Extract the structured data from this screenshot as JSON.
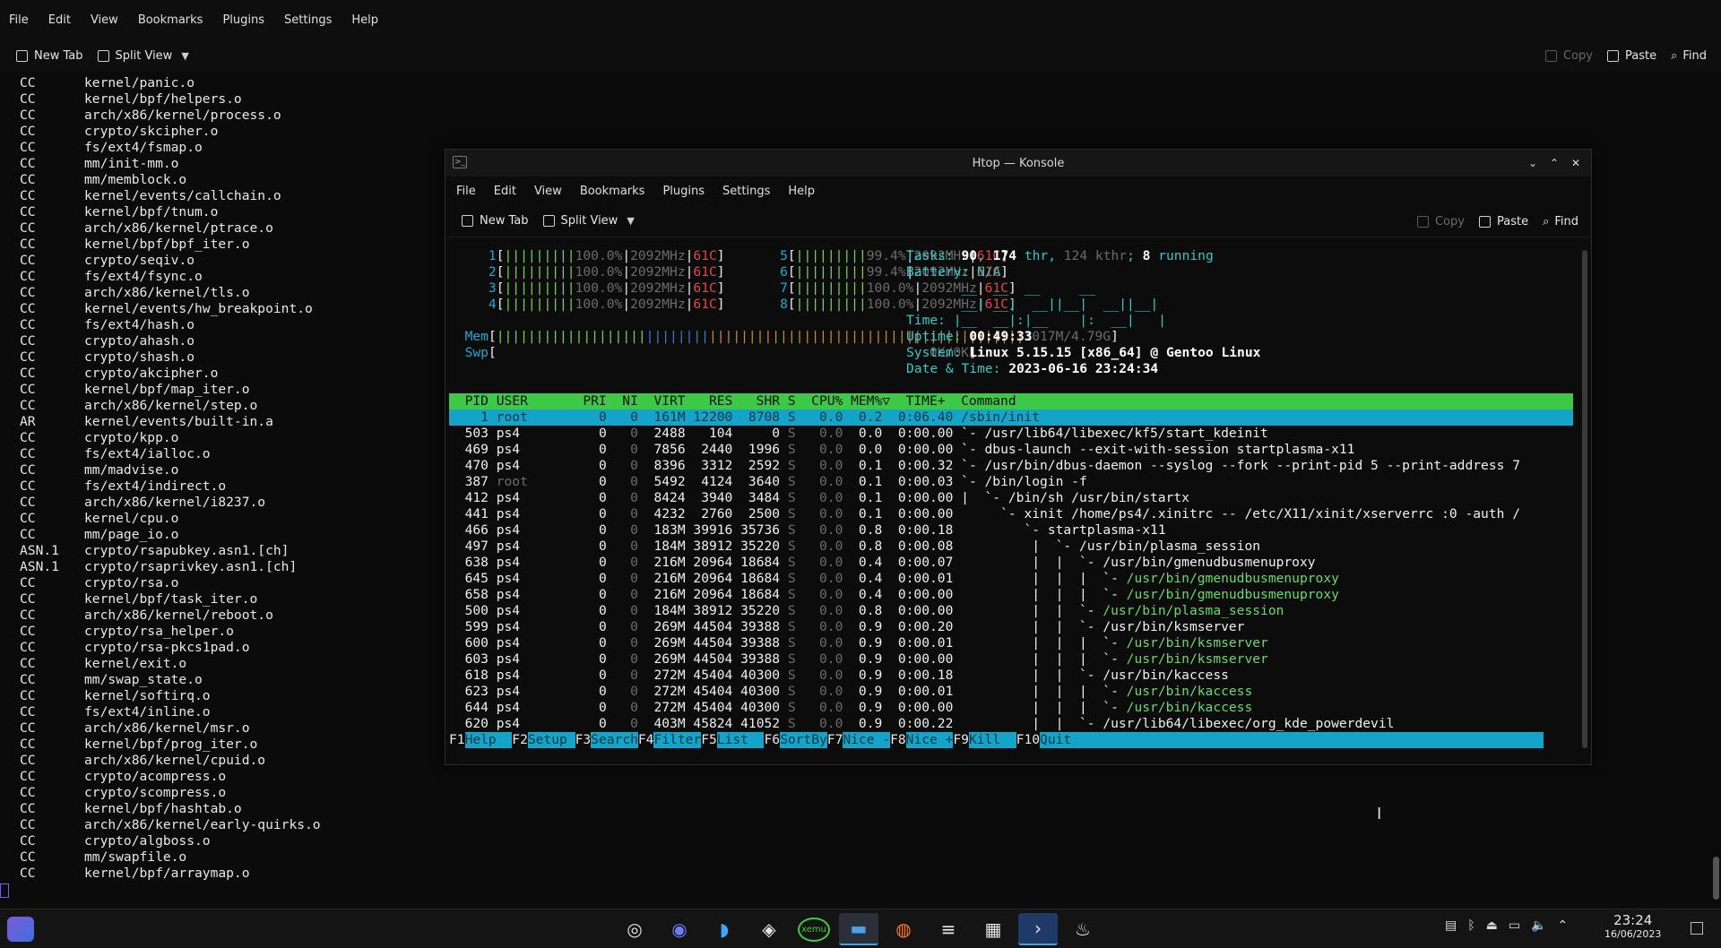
{
  "menu": [
    "File",
    "Edit",
    "View",
    "Bookmarks",
    "Plugins",
    "Settings",
    "Help"
  ],
  "toolbar": {
    "new_tab": "New Tab",
    "split_view": "Split View",
    "copy": "Copy",
    "paste": "Paste",
    "find": "Find"
  },
  "build_log": [
    [
      "CC",
      "kernel/panic.o"
    ],
    [
      "CC",
      "kernel/bpf/helpers.o"
    ],
    [
      "CC",
      "arch/x86/kernel/process.o"
    ],
    [
      "CC",
      "crypto/skcipher.o"
    ],
    [
      "CC",
      "fs/ext4/fsmap.o"
    ],
    [
      "CC",
      "mm/init-mm.o"
    ],
    [
      "CC",
      "mm/memblock.o"
    ],
    [
      "CC",
      "kernel/events/callchain.o"
    ],
    [
      "CC",
      "kernel/bpf/tnum.o"
    ],
    [
      "CC",
      "arch/x86/kernel/ptrace.o"
    ],
    [
      "CC",
      "kernel/bpf/bpf_iter.o"
    ],
    [
      "CC",
      "crypto/seqiv.o"
    ],
    [
      "CC",
      "fs/ext4/fsync.o"
    ],
    [
      "CC",
      "arch/x86/kernel/tls.o"
    ],
    [
      "CC",
      "kernel/events/hw_breakpoint.o"
    ],
    [
      "CC",
      "fs/ext4/hash.o"
    ],
    [
      "CC",
      "crypto/ahash.o"
    ],
    [
      "CC",
      "crypto/shash.o"
    ],
    [
      "CC",
      "crypto/akcipher.o"
    ],
    [
      "CC",
      "kernel/bpf/map_iter.o"
    ],
    [
      "CC",
      "arch/x86/kernel/step.o"
    ],
    [
      "AR",
      "kernel/events/built-in.a"
    ],
    [
      "CC",
      "crypto/kpp.o"
    ],
    [
      "CC",
      "fs/ext4/ialloc.o"
    ],
    [
      "CC",
      "mm/madvise.o"
    ],
    [
      "CC",
      "fs/ext4/indirect.o"
    ],
    [
      "CC",
      "arch/x86/kernel/i8237.o"
    ],
    [
      "CC",
      "kernel/cpu.o"
    ],
    [
      "CC",
      "mm/page_io.o"
    ],
    [
      "ASN.1",
      "crypto/rsapubkey.asn1.[ch]"
    ],
    [
      "ASN.1",
      "crypto/rsaprivkey.asn1.[ch]"
    ],
    [
      "CC",
      "crypto/rsa.o"
    ],
    [
      "CC",
      "kernel/bpf/task_iter.o"
    ],
    [
      "CC",
      "arch/x86/kernel/reboot.o"
    ],
    [
      "CC",
      "crypto/rsa_helper.o"
    ],
    [
      "CC",
      "crypto/rsa-pkcs1pad.o"
    ],
    [
      "CC",
      "kernel/exit.o"
    ],
    [
      "CC",
      "mm/swap_state.o"
    ],
    [
      "CC",
      "kernel/softirq.o"
    ],
    [
      "CC",
      "fs/ext4/inline.o"
    ],
    [
      "CC",
      "arch/x86/kernel/msr.o"
    ],
    [
      "CC",
      "kernel/bpf/prog_iter.o"
    ],
    [
      "CC",
      "arch/x86/kernel/cpuid.o"
    ],
    [
      "CC",
      "crypto/acompress.o"
    ],
    [
      "CC",
      "crypto/scompress.o"
    ],
    [
      "CC",
      "kernel/bpf/hashtab.o"
    ],
    [
      "CC",
      "arch/x86/kernel/early-quirks.o"
    ],
    [
      "CC",
      "crypto/algboss.o"
    ],
    [
      "CC",
      "mm/swapfile.o"
    ],
    [
      "CC",
      "kernel/bpf/arraymap.o"
    ]
  ],
  "window": {
    "title": "Htop — Konsole"
  },
  "htop": {
    "cpus": [
      [
        "1",
        "100.0%",
        "2092MHz",
        "61C"
      ],
      [
        "2",
        "100.0%",
        "2092MHz",
        "61C"
      ],
      [
        "3",
        "100.0%",
        "2092MHz",
        "61C"
      ],
      [
        "4",
        "100.0%",
        "2092MHz",
        "61C"
      ],
      [
        "5",
        "99.4%",
        "2092MHz",
        "61C"
      ],
      [
        "6",
        "99.4%",
        "2092MHz",
        "61C"
      ],
      [
        "7",
        "100.0%",
        "2092MHz",
        "61C"
      ],
      [
        "8",
        "100.0%",
        "2092MHz",
        "61C"
      ]
    ],
    "mem_label": "Mem",
    "mem_value": "1017M/4.79G",
    "swp_label": "Swp",
    "swp_value": "0K/0K",
    "tasks": "90",
    "thr": "174",
    "kthr": "124",
    "running": "8",
    "battery": "N/A",
    "uptime": "00:49:33",
    "system": "Linux 5.15.15 [x86_64] @ Gentoo Linux",
    "datetime": "2023-06-16 23:24:34",
    "ascii_logo": [
      " __  __  __     __     ",
      " __| __|  __||__|  __||__|",
      "Time: |__  __|:|__    |:  __|   |"
    ],
    "columns": "  PID USER       PRI  NI  VIRT   RES   SHR S  CPU% MEM%▽  TIME+  Command",
    "rows": [
      {
        "pid": "1",
        "user": "root",
        "pri": "0",
        "ni": "0",
        "virt": "161M",
        "res": "12200",
        "shr": "8708",
        "s": "S",
        "cpu": "0.0",
        "mem": "0.2",
        "time": "0:06.40",
        "cmd": "/sbin/init",
        "tree": ""
      },
      {
        "pid": "503",
        "user": "ps4",
        "pri": "0",
        "ni": "0",
        "virt": "2488",
        "res": "104",
        "shr": "0",
        "s": "S",
        "cpu": "0.0",
        "mem": "0.0",
        "time": "0:00.00",
        "cmd": "/usr/lib64/libexec/kf5/start_kdeinit",
        "tree": "`- "
      },
      {
        "pid": "469",
        "user": "ps4",
        "pri": "0",
        "ni": "0",
        "virt": "7856",
        "res": "2440",
        "shr": "1996",
        "s": "S",
        "cpu": "0.0",
        "mem": "0.0",
        "time": "0:00.00",
        "cmd": "dbus-launch --exit-with-session startplasma-x11",
        "tree": "`- "
      },
      {
        "pid": "470",
        "user": "ps4",
        "pri": "0",
        "ni": "0",
        "virt": "8396",
        "res": "3312",
        "shr": "2592",
        "s": "S",
        "cpu": "0.0",
        "mem": "0.1",
        "time": "0:00.32",
        "cmd": "/usr/bin/dbus-daemon --syslog --fork --print-pid 5 --print-address 7",
        "tree": "`- "
      },
      {
        "pid": "387",
        "user": "root",
        "pri": "0",
        "ni": "0",
        "virt": "5492",
        "res": "4124",
        "shr": "3640",
        "s": "S",
        "cpu": "0.0",
        "mem": "0.1",
        "time": "0:00.03",
        "cmd": "/bin/login -f",
        "tree": "`- "
      },
      {
        "pid": "412",
        "user": "ps4",
        "pri": "0",
        "ni": "0",
        "virt": "8424",
        "res": "3940",
        "shr": "3484",
        "s": "S",
        "cpu": "0.0",
        "mem": "0.1",
        "time": "0:00.00",
        "cmd": "/bin/sh /usr/bin/startx",
        "tree": "|  `- "
      },
      {
        "pid": "441",
        "user": "ps4",
        "pri": "0",
        "ni": "0",
        "virt": "4232",
        "res": "2760",
        "shr": "2500",
        "s": "S",
        "cpu": "0.0",
        "mem": "0.1",
        "time": "0:00.00",
        "cmd": "xinit /home/ps4/.xinitrc -- /etc/X11/xinit/xserverrc :0 -auth /",
        "tree": "     `- "
      },
      {
        "pid": "466",
        "user": "ps4",
        "pri": "0",
        "ni": "0",
        "virt": "183M",
        "res": "39916",
        "shr": "35736",
        "s": "S",
        "cpu": "0.0",
        "mem": "0.8",
        "time": "0:00.18",
        "cmd": "startplasma-x11",
        "tree": "        `- "
      },
      {
        "pid": "497",
        "user": "ps4",
        "pri": "0",
        "ni": "0",
        "virt": "184M",
        "res": "38912",
        "shr": "35220",
        "s": "S",
        "cpu": "0.0",
        "mem": "0.8",
        "time": "0:00.08",
        "cmd": "/usr/bin/plasma_session",
        "tree": "         |  `- "
      },
      {
        "pid": "638",
        "user": "ps4",
        "pri": "0",
        "ni": "0",
        "virt": "216M",
        "res": "20964",
        "shr": "18684",
        "s": "S",
        "cpu": "0.0",
        "mem": "0.4",
        "time": "0:00.07",
        "cmd": "/usr/bin/gmenudbusmenuproxy",
        "tree": "         |  |  `- "
      },
      {
        "pid": "645",
        "user": "ps4",
        "pri": "0",
        "ni": "0",
        "virt": "216M",
        "res": "20964",
        "shr": "18684",
        "s": "S",
        "cpu": "0.0",
        "mem": "0.4",
        "time": "0:00.01",
        "cmd": "/usr/bin/gmenudbusmenuproxy",
        "tree": "         |  |  |  `- ",
        "thread": true
      },
      {
        "pid": "658",
        "user": "ps4",
        "pri": "0",
        "ni": "0",
        "virt": "216M",
        "res": "20964",
        "shr": "18684",
        "s": "S",
        "cpu": "0.0",
        "mem": "0.4",
        "time": "0:00.00",
        "cmd": "/usr/bin/gmenudbusmenuproxy",
        "tree": "         |  |  |  `- ",
        "thread": true
      },
      {
        "pid": "500",
        "user": "ps4",
        "pri": "0",
        "ni": "0",
        "virt": "184M",
        "res": "38912",
        "shr": "35220",
        "s": "S",
        "cpu": "0.0",
        "mem": "0.8",
        "time": "0:00.00",
        "cmd": "/usr/bin/plasma_session",
        "tree": "         |  |  `- ",
        "thread": true
      },
      {
        "pid": "599",
        "user": "ps4",
        "pri": "0",
        "ni": "0",
        "virt": "269M",
        "res": "44504",
        "shr": "39388",
        "s": "S",
        "cpu": "0.0",
        "mem": "0.9",
        "time": "0:00.20",
        "cmd": "/usr/bin/ksmserver",
        "tree": "         |  |  `- "
      },
      {
        "pid": "600",
        "user": "ps4",
        "pri": "0",
        "ni": "0",
        "virt": "269M",
        "res": "44504",
        "shr": "39388",
        "s": "S",
        "cpu": "0.0",
        "mem": "0.9",
        "time": "0:00.01",
        "cmd": "/usr/bin/ksmserver",
        "tree": "         |  |  |  `- ",
        "thread": true
      },
      {
        "pid": "603",
        "user": "ps4",
        "pri": "0",
        "ni": "0",
        "virt": "269M",
        "res": "44504",
        "shr": "39388",
        "s": "S",
        "cpu": "0.0",
        "mem": "0.9",
        "time": "0:00.00",
        "cmd": "/usr/bin/ksmserver",
        "tree": "         |  |  |  `- ",
        "thread": true
      },
      {
        "pid": "618",
        "user": "ps4",
        "pri": "0",
        "ni": "0",
        "virt": "272M",
        "res": "45404",
        "shr": "40300",
        "s": "S",
        "cpu": "0.0",
        "mem": "0.9",
        "time": "0:00.18",
        "cmd": "/usr/bin/kaccess",
        "tree": "         |  |  `- "
      },
      {
        "pid": "623",
        "user": "ps4",
        "pri": "0",
        "ni": "0",
        "virt": "272M",
        "res": "45404",
        "shr": "40300",
        "s": "S",
        "cpu": "0.0",
        "mem": "0.9",
        "time": "0:00.01",
        "cmd": "/usr/bin/kaccess",
        "tree": "         |  |  |  `- ",
        "thread": true
      },
      {
        "pid": "644",
        "user": "ps4",
        "pri": "0",
        "ni": "0",
        "virt": "272M",
        "res": "45404",
        "shr": "40300",
        "s": "S",
        "cpu": "0.0",
        "mem": "0.9",
        "time": "0:00.00",
        "cmd": "/usr/bin/kaccess",
        "tree": "         |  |  |  `- ",
        "thread": true
      },
      {
        "pid": "620",
        "user": "ps4",
        "pri": "0",
        "ni": "0",
        "virt": "403M",
        "res": "45824",
        "shr": "41052",
        "s": "S",
        "cpu": "0.0",
        "mem": "0.9",
        "time": "0:00.22",
        "cmd": "/usr/lib64/libexec/org_kde_powerdevil",
        "tree": "         |  |  `- "
      }
    ],
    "fkeys": [
      [
        "F1",
        "Help  "
      ],
      [
        "F2",
        "Setup "
      ],
      [
        "F3",
        "Search"
      ],
      [
        "F4",
        "Filter"
      ],
      [
        "F5",
        "List  "
      ],
      [
        "F6",
        "SortBy"
      ],
      [
        "F7",
        "Nice -"
      ],
      [
        "F8",
        "Nice +"
      ],
      [
        "F9",
        "Kill  "
      ],
      [
        "F10",
        "Quit"
      ]
    ]
  },
  "taskbar": {
    "apps": [
      "steam-icon",
      "discord-icon",
      "dolphin-emu-icon",
      "virtualbox-icon",
      "xemu-icon",
      "file-manager-icon",
      "firefox-icon",
      "mixer-icon",
      "system-monitor-icon",
      "konsole-icon",
      "flame-icon"
    ],
    "xemu_label": "xemu",
    "clock_time": "23:24",
    "clock_date": "16/06/2023"
  },
  "colors": {
    "header_green": "#3dc845",
    "select_cyan": "#15a4c9",
    "cyan": "#21a9d6",
    "green": "#77d35a",
    "red": "#e04848"
  }
}
